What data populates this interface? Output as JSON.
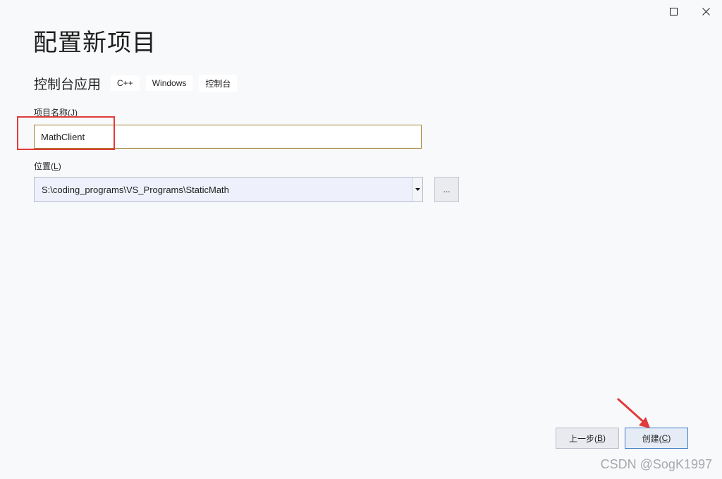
{
  "window": {
    "maximize_icon": "maximize-icon",
    "close_icon": "close-icon"
  },
  "title": "配置新项目",
  "template": {
    "name": "控制台应用",
    "tags": [
      "C++",
      "Windows",
      "控制台"
    ]
  },
  "project_name": {
    "label_prefix": "项目名称(",
    "label_key": "J",
    "label_suffix": ")",
    "value": "MathClient"
  },
  "location": {
    "label_prefix": "位置(",
    "label_key": "L",
    "label_suffix": ")",
    "value": "S:\\coding_programs\\VS_Programs\\StaticMath",
    "browse_label": "..."
  },
  "buttons": {
    "back_prefix": "上一步(",
    "back_key": "B",
    "back_suffix": ")",
    "create_prefix": "创建(",
    "create_key": "C",
    "create_suffix": ")"
  },
  "watermark": "CSDN @SogK1997",
  "colors": {
    "highlight": "#e23b3b",
    "input_border": "#a0822c",
    "create_border": "#3d7bc4"
  }
}
